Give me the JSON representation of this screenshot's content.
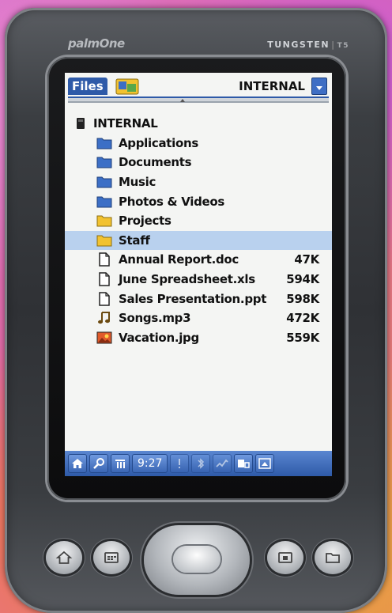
{
  "device": {
    "brand": "palmOne",
    "model": "TUNGSTEN",
    "model_suffix": "T5"
  },
  "titlebar": {
    "app_name": "Files",
    "location": "INTERNAL"
  },
  "file_list": {
    "root": {
      "label": "INTERNAL",
      "icon": "memory-card-icon"
    },
    "items": [
      {
        "name": "Applications",
        "type": "folder",
        "size": ""
      },
      {
        "name": "Documents",
        "type": "folder",
        "size": ""
      },
      {
        "name": "Music",
        "type": "folder",
        "size": ""
      },
      {
        "name": "Photos & Videos",
        "type": "folder",
        "size": ""
      },
      {
        "name": "Projects",
        "type": "folder-yellow",
        "size": ""
      },
      {
        "name": "Staff",
        "type": "folder-yellow",
        "size": "",
        "selected": true
      },
      {
        "name": "Annual Report.doc",
        "type": "document",
        "size": "47K"
      },
      {
        "name": "June Spreadsheet.xls",
        "type": "document",
        "size": "594K"
      },
      {
        "name": "Sales Presentation.ppt",
        "type": "document",
        "size": "598K"
      },
      {
        "name": "Songs.mp3",
        "type": "music",
        "size": "472K"
      },
      {
        "name": "Vacation.jpg",
        "type": "image",
        "size": "559K"
      }
    ]
  },
  "statusbar": {
    "clock": "9:27",
    "icons": [
      "home-icon",
      "find-icon",
      "menu-icon",
      "alert-icon",
      "bluetooth-icon",
      "signal-icon",
      "input-area-icon",
      "toggle-input-icon"
    ]
  },
  "colors": {
    "accent": "#2e5aa8",
    "selection": "#b9d1ee",
    "folder_blue": "#3c6fc6",
    "folder_yellow": "#f2c230"
  }
}
